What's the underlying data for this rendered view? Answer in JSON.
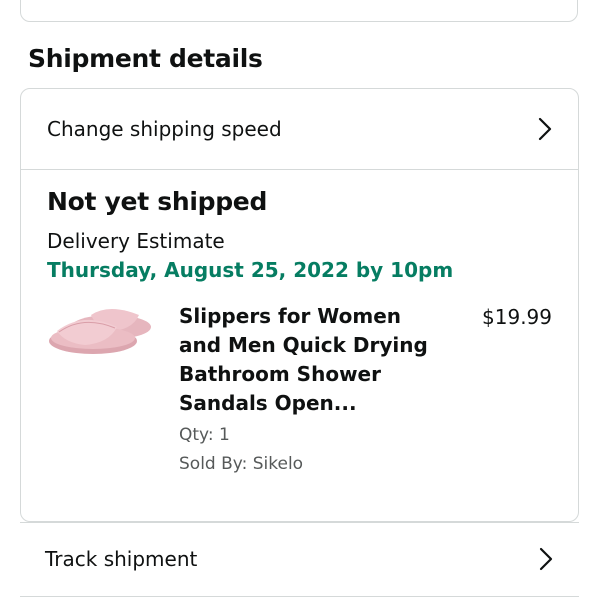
{
  "shipment": {
    "section_title": "Shipment details",
    "change_speed_label": "Change shipping speed",
    "status": "Not yet shipped",
    "delivery_estimate_label": "Delivery Estimate",
    "delivery_date": "Thursday, August 25, 2022 by 10pm",
    "item": {
      "title": "Slippers for Women and Men Quick Drying Bathroom Shower Sandals Open...",
      "price": "$19.99",
      "qty": "Qty: 1",
      "sold_by": "Sold By: Sikelo",
      "image_icon": "pink-slide-sandals-image"
    },
    "track_label": "Track shipment"
  },
  "colors": {
    "delivery_green": "#067d62",
    "border": "#d5d9d9",
    "muted_text": "#565959",
    "product_pink": "#e8b9c0"
  }
}
